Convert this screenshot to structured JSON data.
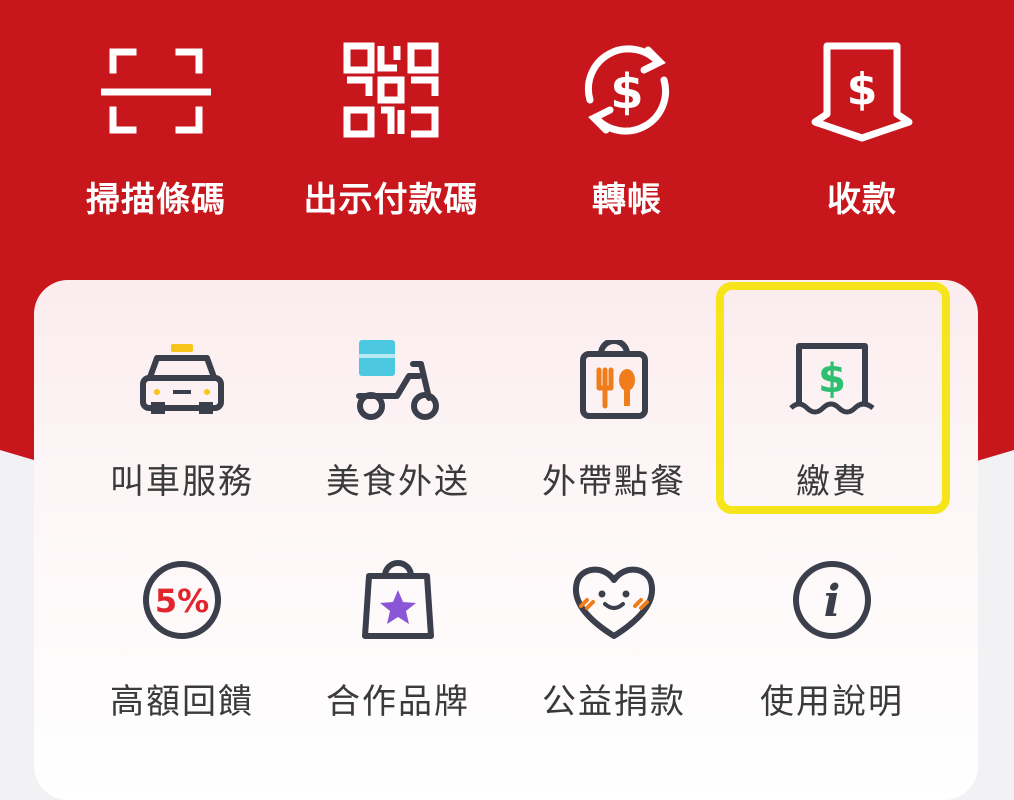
{
  "top_actions": [
    {
      "label": "掃描條碼",
      "icon": "scan-icon"
    },
    {
      "label": "出示付款碼",
      "icon": "qr-code-icon"
    },
    {
      "label": "轉帳",
      "icon": "transfer-icon"
    },
    {
      "label": "收款",
      "icon": "receive-money-icon"
    }
  ],
  "services": [
    {
      "label": "叫車服務",
      "icon": "taxi-icon"
    },
    {
      "label": "美食外送",
      "icon": "delivery-scooter-icon"
    },
    {
      "label": "外帶點餐",
      "icon": "takeout-bag-icon"
    },
    {
      "label": "繳費",
      "icon": "bill-payment-icon"
    },
    {
      "label": "高額回饋",
      "icon": "five-percent-icon"
    },
    {
      "label": "合作品牌",
      "icon": "shopping-bag-star-icon"
    },
    {
      "label": "公益捐款",
      "icon": "heart-smile-icon"
    },
    {
      "label": "使用說明",
      "icon": "info-icon"
    }
  ],
  "icon_texts": {
    "dollar": "$",
    "percent": "5%",
    "info": "i"
  },
  "colors": {
    "brand_red": "#c8161d",
    "highlight": "#f5e51a",
    "icon_dark": "#3a3f4b",
    "accent_yellow": "#f7c51a",
    "accent_orange": "#f07d1c",
    "accent_cyan": "#4cc9e0",
    "accent_green": "#2fbf71",
    "accent_purple": "#8a55d6",
    "badge_red": "#e0262c"
  }
}
